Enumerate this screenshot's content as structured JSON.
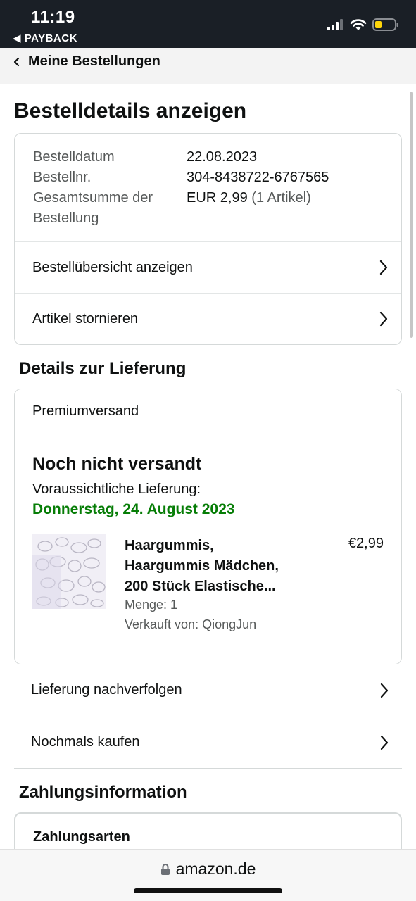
{
  "status_bar": {
    "time": "11:19",
    "back_app": "PAYBACK",
    "back_icon": "triangle-left-icon",
    "icons": [
      "signal-icon",
      "wifi-icon",
      "battery-icon"
    ],
    "battery_color": "#ffd60a"
  },
  "nav": {
    "back_label": "Meine Bestellungen",
    "back_icon": "chevron-left-icon"
  },
  "page": {
    "title": "Bestelldetails anzeigen"
  },
  "order_summary": {
    "date_label": "Bestelldatum",
    "date_value": "22.08.2023",
    "number_label": "Bestellnr.",
    "number_value": "304-8438722-6767565",
    "total_label_line1": "Gesamtsumme der",
    "total_label_line2": "Bestellung",
    "total_value": "EUR 2,99",
    "total_items": "(1 Artikel)",
    "links": [
      {
        "label": "Bestellübersicht anzeigen",
        "icon": "chevron-right-icon"
      },
      {
        "label": "Artikel stornieren",
        "icon": "chevron-right-icon"
      }
    ]
  },
  "delivery": {
    "section_title": "Details zur Lieferung",
    "shipping_method": "Premiumversand",
    "status": "Noch nicht versandt",
    "eta_label": "Voraussichtliche Lieferung:",
    "eta_date": "Donnerstag, 24. August 2023",
    "eta_color": "#067d06",
    "item": {
      "title_lines": [
        "Haargummis,",
        "Haargummis Mädchen,",
        "200 Stück Elastische..."
      ],
      "price": "€2,99",
      "quantity": "Menge: 1",
      "seller": "Verkauft von: QiongJun",
      "image": "product-thumbnail"
    },
    "actions": [
      {
        "label": "Lieferung nachverfolgen",
        "icon": "chevron-right-icon"
      },
      {
        "label": "Nochmals kaufen",
        "icon": "chevron-right-icon"
      }
    ]
  },
  "payment": {
    "section_title": "Zahlungsinformation",
    "card_title": "Zahlungsarten"
  },
  "browser": {
    "url": "amazon.de",
    "lock_icon": "lock-icon"
  }
}
